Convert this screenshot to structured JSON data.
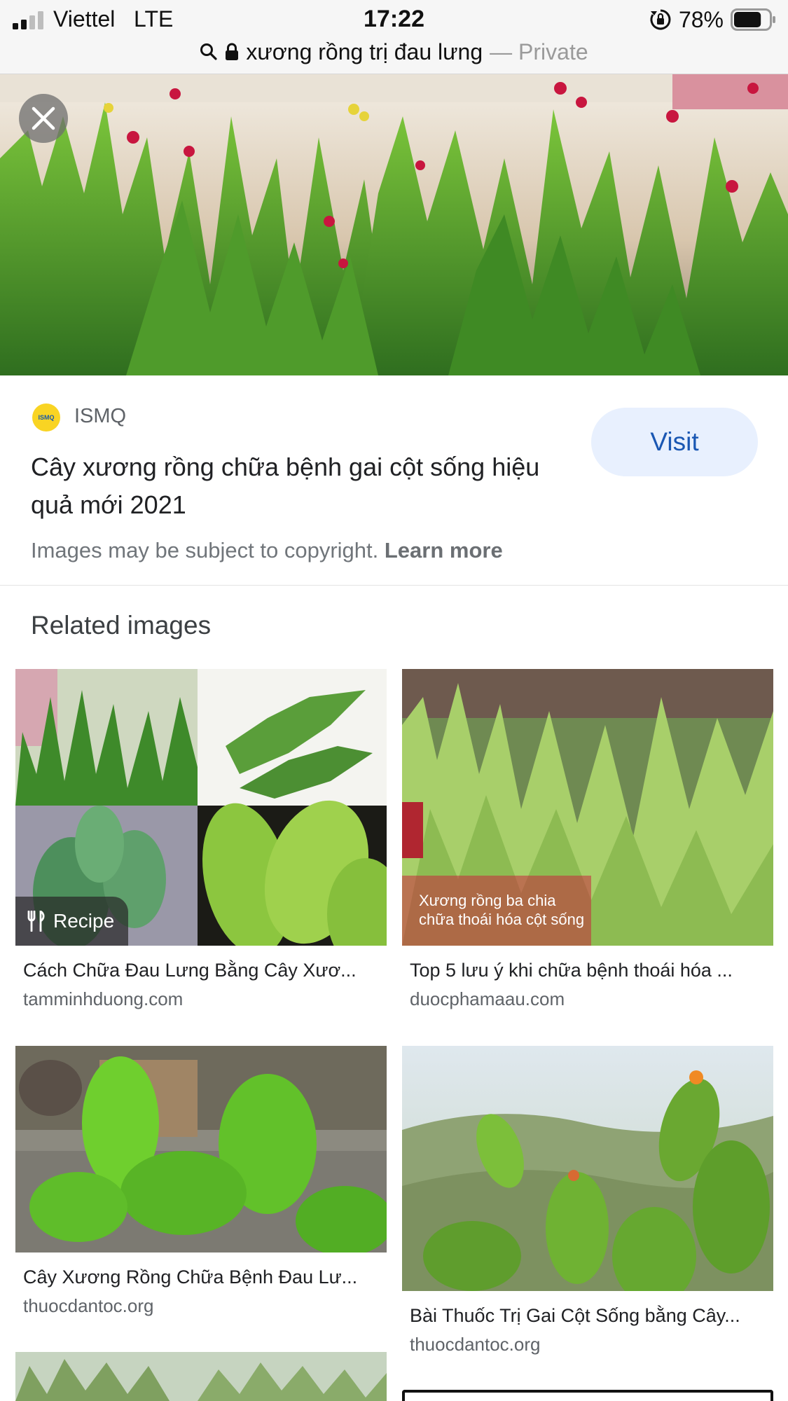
{
  "status_bar": {
    "carrier": "Viettel",
    "network": "LTE",
    "time": "17:22",
    "battery": "78%",
    "battery_level": 0.78,
    "icons": [
      "signal-icon",
      "orientation-lock-icon",
      "battery-icon"
    ]
  },
  "address_bar": {
    "query": "xương rồng trị đau lưng",
    "separator": "—",
    "mode": "Private",
    "icons": [
      "search-icon",
      "lock-icon"
    ]
  },
  "hero": {
    "close_icon": "close-icon"
  },
  "source": {
    "name": "ISMQ",
    "logo_text": "ISMQ",
    "title": "Cây xương rồng chữa bệnh gai cột sống hiệu quả mới 2021",
    "visit_label": "Visit",
    "copyright": "Images may be subject to copyright.",
    "learn_more": "Learn more"
  },
  "related": {
    "heading": "Related images",
    "items": [
      {
        "caption": "Cách Chữa Đau Lưng Bằng Cây Xươ...",
        "domain": "tamminhduong.com",
        "badge": "Recipe",
        "badge_icon": "fork-knife-icon"
      },
      {
        "caption": "Top 5 lưu ý khi chữa bệnh thoái hóa ...",
        "domain": "duocphamaau.com",
        "overlay_line1": "Xương rồng ba chia",
        "overlay_line2": "chữa thoái hóa cột sống"
      },
      {
        "caption": "Cây Xương Rồng Chữa Bệnh Đau Lư...",
        "domain": "thuocdantoc.org"
      },
      {
        "caption": "Bài Thuốc Trị Gai Cột Sống bằng Cây...",
        "domain": "thuocdantoc.org"
      }
    ]
  },
  "colors": {
    "accent": "#1a57b3",
    "visit_bg": "#e8f0fe",
    "text": "#202124",
    "muted": "#70757a"
  }
}
